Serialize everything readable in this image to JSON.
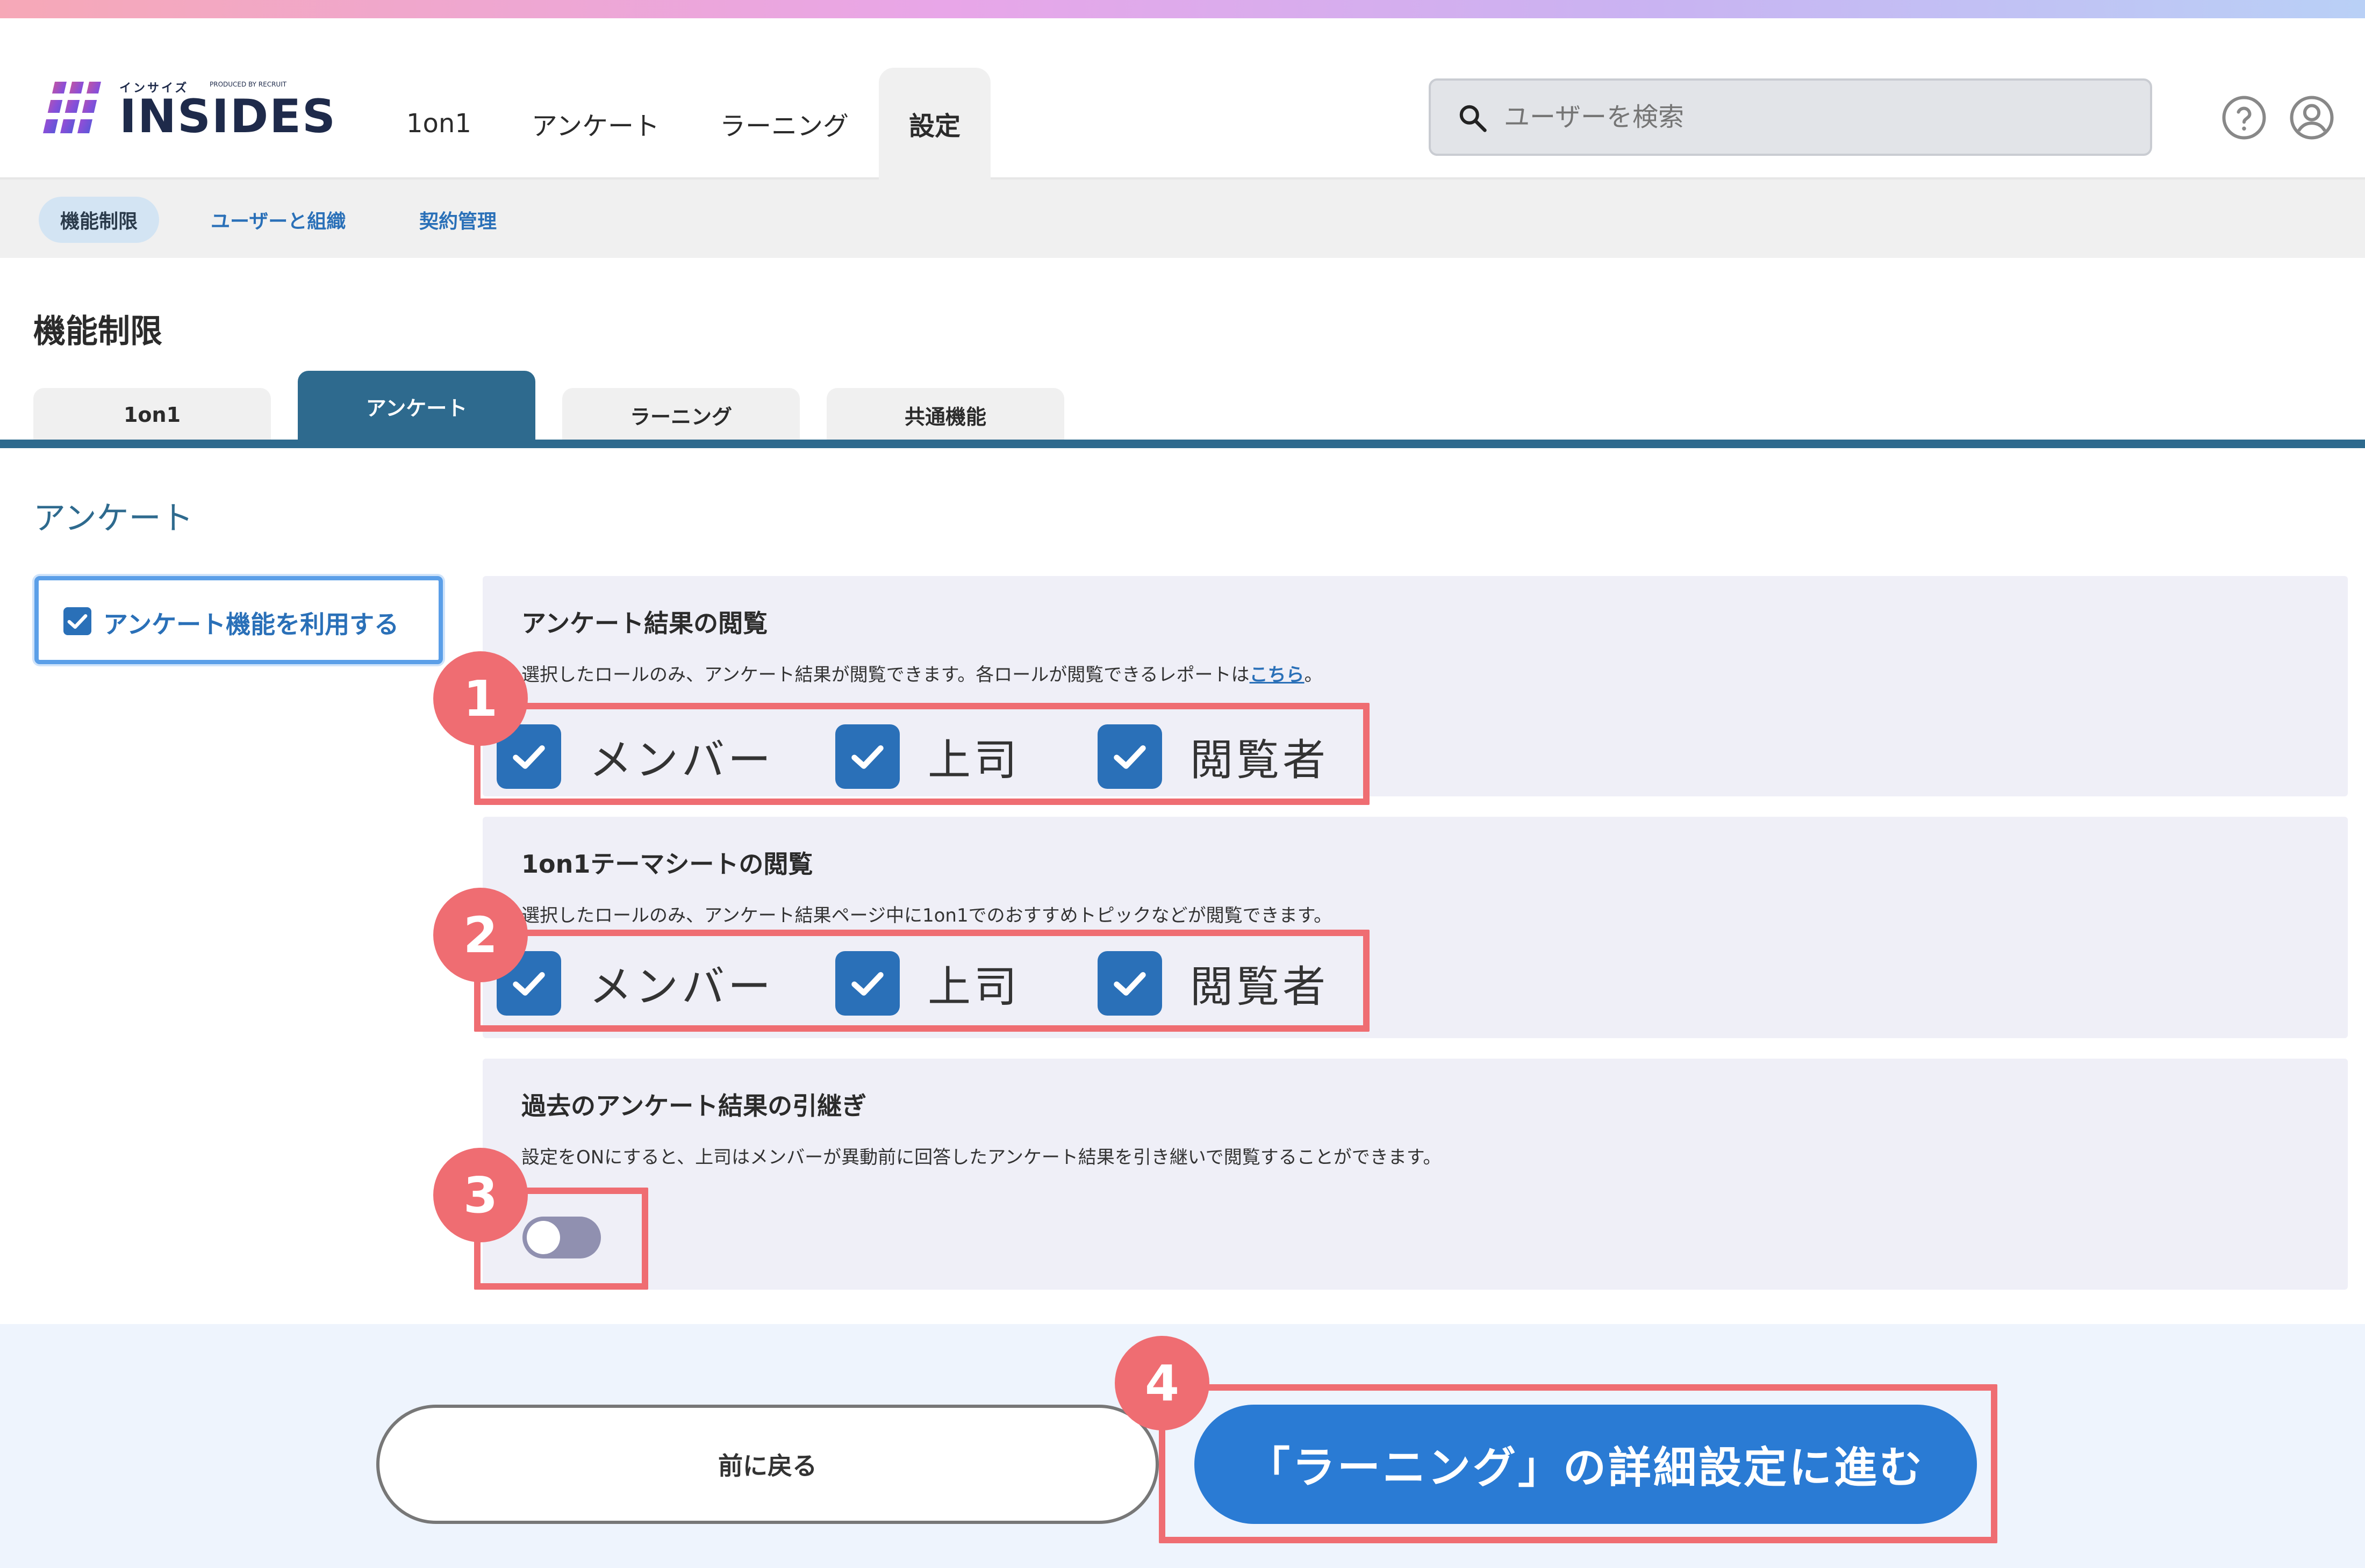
{
  "header": {
    "logo_kana": "インサイズ",
    "logo_produced": "PRODUCED BY RECRUIT",
    "logo_text": "INSIDES",
    "nav": [
      {
        "label": "1on1"
      },
      {
        "label": "アンケート"
      },
      {
        "label": "ラーニング"
      },
      {
        "label": "設定"
      }
    ],
    "search_placeholder": "ユーザーを検索"
  },
  "icons": {
    "search": "search-icon",
    "help": "help-icon",
    "user": "user-icon",
    "check": "checkmark-icon"
  },
  "subnav": [
    {
      "label": "機能制限"
    },
    {
      "label": "ユーザーと組織"
    },
    {
      "label": "契約管理"
    }
  ],
  "page_title": "機能制限",
  "tabs": [
    {
      "label": "1on1"
    },
    {
      "label": "アンケート"
    },
    {
      "label": "ラーニング"
    },
    {
      "label": "共通機能"
    }
  ],
  "section_title": "アンケート",
  "feature_toggle": {
    "label": "アンケート機能を利用する",
    "checked": true
  },
  "panels": {
    "results": {
      "title": "アンケート結果の閲覧",
      "desc": "選択したロールのみ、アンケート結果が閲覧できます。各ロールが閲覧できるレポートは",
      "link": "こちら",
      "desc_tail": "。",
      "roles": [
        {
          "label": "メンバー",
          "checked": true
        },
        {
          "label": "上司",
          "checked": true
        },
        {
          "label": "閲覧者",
          "checked": true
        }
      ]
    },
    "themesheet": {
      "title": "1on1テーマシートの閲覧",
      "desc": "選択したロールのみ、アンケート結果ページ中に1on1でのおすすめトピックなどが閲覧できます。",
      "roles": [
        {
          "label": "メンバー",
          "checked": true
        },
        {
          "label": "上司",
          "checked": true
        },
        {
          "label": "閲覧者",
          "checked": true
        }
      ]
    },
    "inherit": {
      "title": "過去のアンケート結果の引継ぎ",
      "desc": "設定をONにすると、上司はメンバーが異動前に回答したアンケート結果を引き継いで閲覧することができます。",
      "toggle_on": false
    }
  },
  "badges": [
    "1",
    "2",
    "3",
    "4"
  ],
  "footer": {
    "back_label": "前に戻る",
    "next_label": "「ラーニング」の詳細設定に進む"
  },
  "colors": {
    "primary": "#2a70b8",
    "tab_active": "#2e6a8e",
    "highlight": "#ef6d72",
    "panel_bg": "#efeff7"
  }
}
